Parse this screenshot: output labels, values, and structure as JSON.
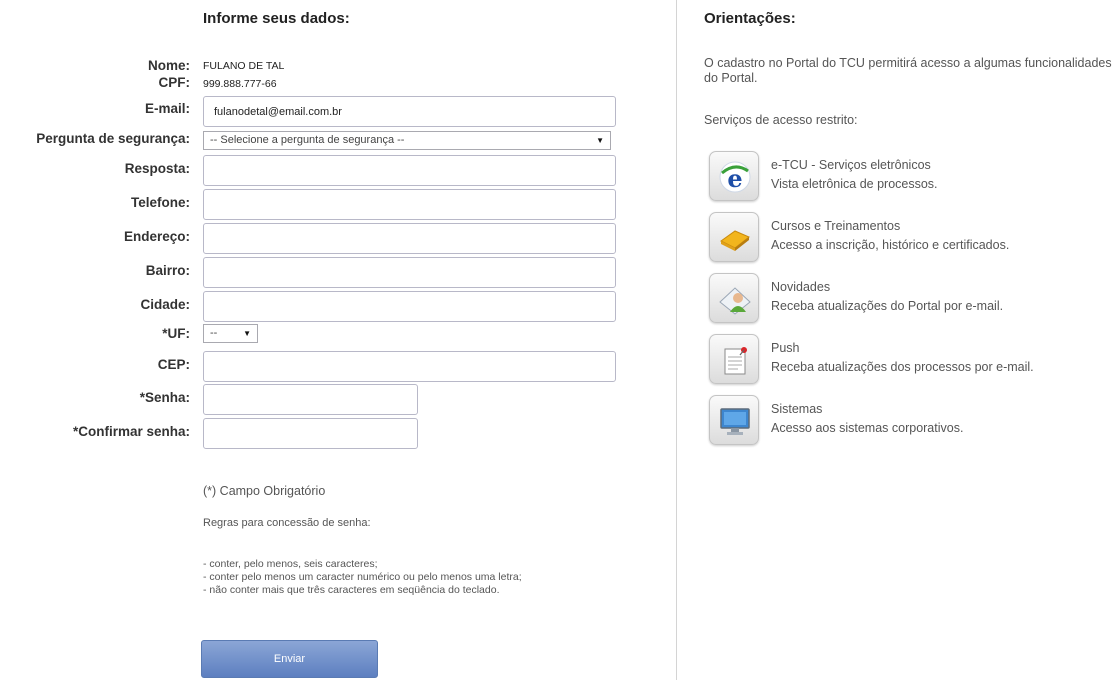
{
  "left": {
    "heading": "Informe seus dados:",
    "nome": {
      "label": "Nome:",
      "value": "FULANO DE TAL"
    },
    "cpf": {
      "label": "CPF:",
      "value": "999.888.777-66"
    },
    "email": {
      "label": "E-mail:",
      "value": "fulanodetal@email.com.br"
    },
    "pergunta": {
      "label": "Pergunta de segurança:",
      "selected": "-- Selecione a pergunta de segurança --"
    },
    "resposta": {
      "label": "Resposta:",
      "value": ""
    },
    "telefone": {
      "label": "Telefone:",
      "value": ""
    },
    "endereco": {
      "label": "Endereço:",
      "value": ""
    },
    "bairro": {
      "label": "Bairro:",
      "value": ""
    },
    "cidade": {
      "label": "Cidade:",
      "value": ""
    },
    "uf": {
      "label": "*UF:",
      "selected": "--"
    },
    "cep": {
      "label": "CEP:",
      "value": ""
    },
    "senha": {
      "label": "*Senha:",
      "value": ""
    },
    "confirmar": {
      "label": "*Confirmar senha:",
      "value": ""
    },
    "required_note": "(*) Campo Obrigatório",
    "rules_title": "Regras para concessão de senha:",
    "rules": [
      "- conter, pelo menos, seis caracteres;",
      "- conter pelo menos um caracter numérico ou pelo menos uma letra;",
      "- não conter mais que três caracteres em seqüência do teclado."
    ],
    "submit_label": "Enviar"
  },
  "right": {
    "heading": "Orientações:",
    "intro": "O cadastro no Portal do TCU permitirá acesso a algumas funcionalidades do Portal.",
    "services_title": "Serviços de acesso restrito:",
    "services": [
      {
        "icon": "etcu-icon",
        "title": "e-TCU - Serviços eletrônicos",
        "desc": "Vista eletrônica de processos."
      },
      {
        "icon": "courses-icon",
        "title": "Cursos e Treinamentos",
        "desc": "Acesso a inscrição, histórico e certificados."
      },
      {
        "icon": "news-icon",
        "title": "Novidades",
        "desc": "Receba atualizações do Portal por e-mail."
      },
      {
        "icon": "push-icon",
        "title": "Push",
        "desc": "Receba atualizações dos processos por e-mail."
      },
      {
        "icon": "systems-icon",
        "title": "Sistemas",
        "desc": "Acesso aos sistemas corporativos."
      }
    ]
  },
  "colors": {
    "button": "#6d8cc8",
    "divider": "#d4d4d4",
    "text": "#555555"
  }
}
